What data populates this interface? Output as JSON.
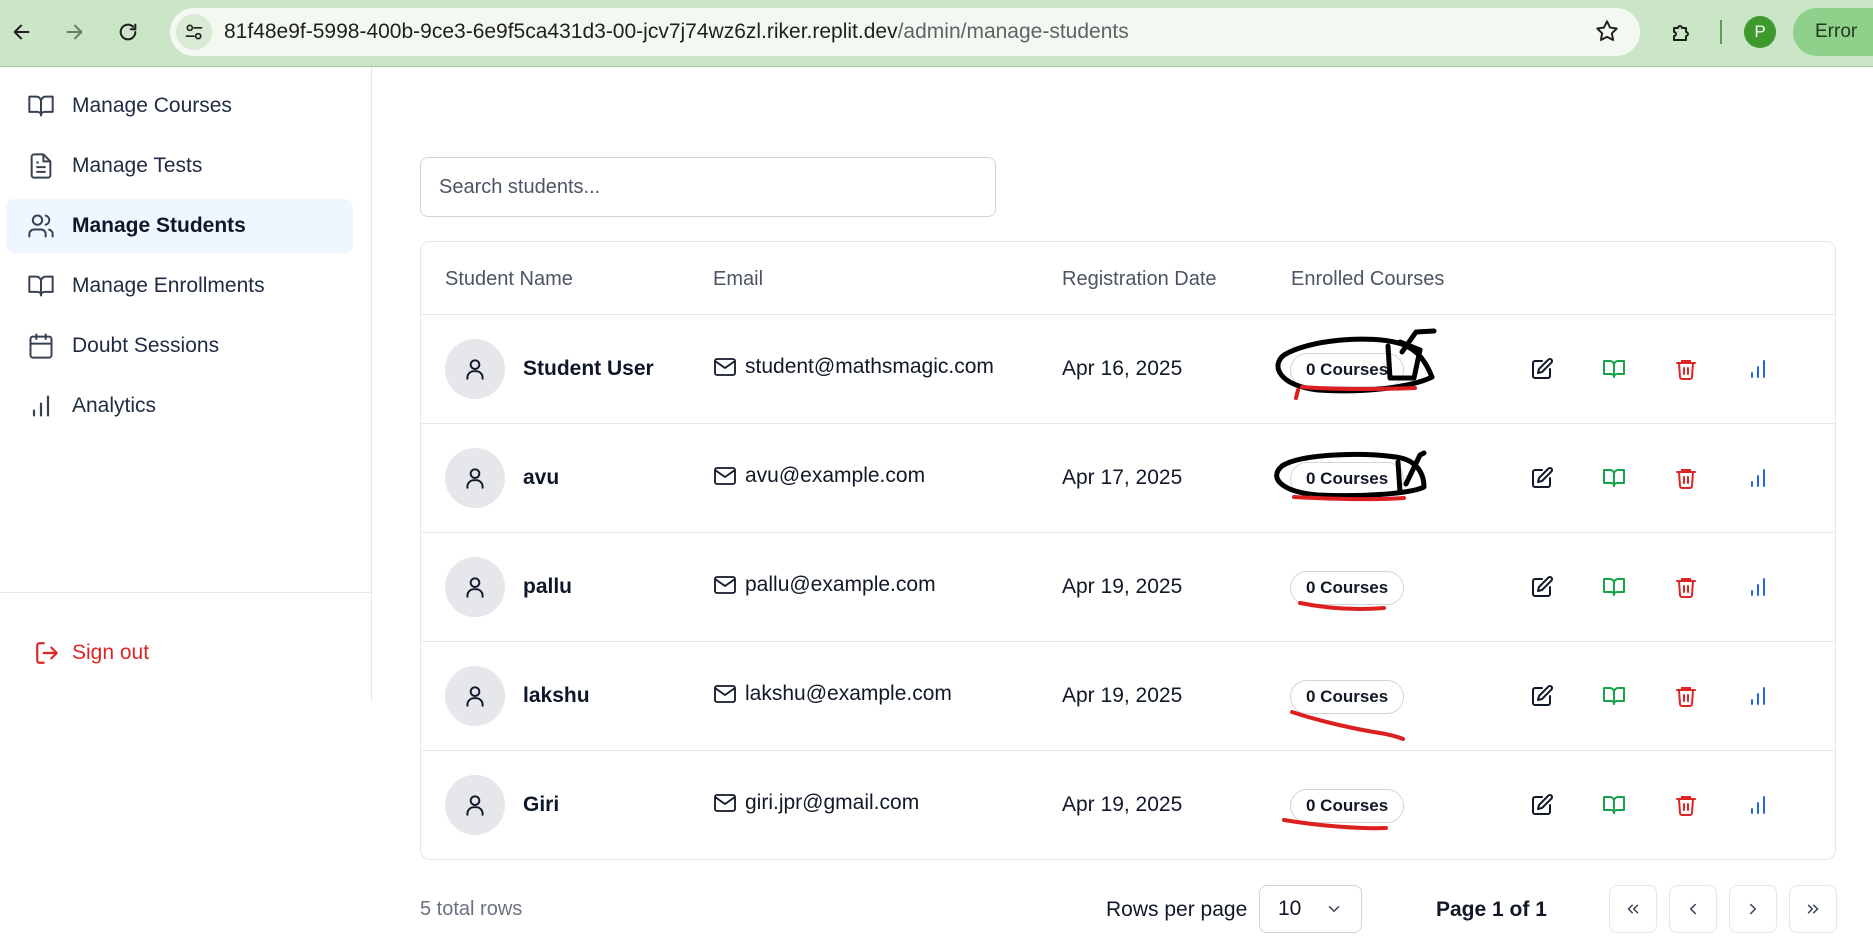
{
  "browser": {
    "url_host": "81f48e9f-5998-400b-9ce3-6e9f5ca431d3-00-jcv7j74wz6zl.riker.replit.dev",
    "url_path": "/admin/manage-students",
    "profile_initial": "P",
    "error_label": "Error"
  },
  "sidebar": {
    "items": [
      {
        "label": "Manage Courses",
        "icon": "book-open-icon"
      },
      {
        "label": "Manage Tests",
        "icon": "file-text-icon"
      },
      {
        "label": "Manage Students",
        "icon": "users-icon",
        "active": true
      },
      {
        "label": "Manage Enrollments",
        "icon": "book-open-icon"
      },
      {
        "label": "Doubt Sessions",
        "icon": "calendar-icon"
      },
      {
        "label": "Analytics",
        "icon": "bar-chart-icon"
      }
    ],
    "signout_label": "Sign out"
  },
  "search": {
    "placeholder": "Search students..."
  },
  "table": {
    "headers": [
      "Student Name",
      "Email",
      "Registration Date",
      "Enrolled Courses"
    ],
    "rows": [
      {
        "name": "Student User",
        "email": "student@mathsmagic.com",
        "date": "Apr 16, 2025",
        "courses": "0 Courses"
      },
      {
        "name": "avu",
        "email": "avu@example.com",
        "date": "Apr 17, 2025",
        "courses": "0 Courses"
      },
      {
        "name": "pallu",
        "email": "pallu@example.com",
        "date": "Apr 19, 2025",
        "courses": "0 Courses"
      },
      {
        "name": "lakshu",
        "email": "lakshu@example.com",
        "date": "Apr 19, 2025",
        "courses": "0 Courses"
      },
      {
        "name": "Giri",
        "email": "giri.jpr@gmail.com",
        "date": "Apr 19, 2025",
        "courses": "0 Courses"
      }
    ]
  },
  "footer": {
    "total_rows": "5 total rows",
    "rows_per_page_label": "Rows per page",
    "rows_per_page_value": "10",
    "page_info": "Page 1 of 1"
  },
  "colors": {
    "edit": "#111827",
    "enroll": "#16a34a",
    "delete": "#dc2626",
    "stats": "#2563eb",
    "annotation_black": "#000000",
    "annotation_red": "#dc1f1f"
  }
}
